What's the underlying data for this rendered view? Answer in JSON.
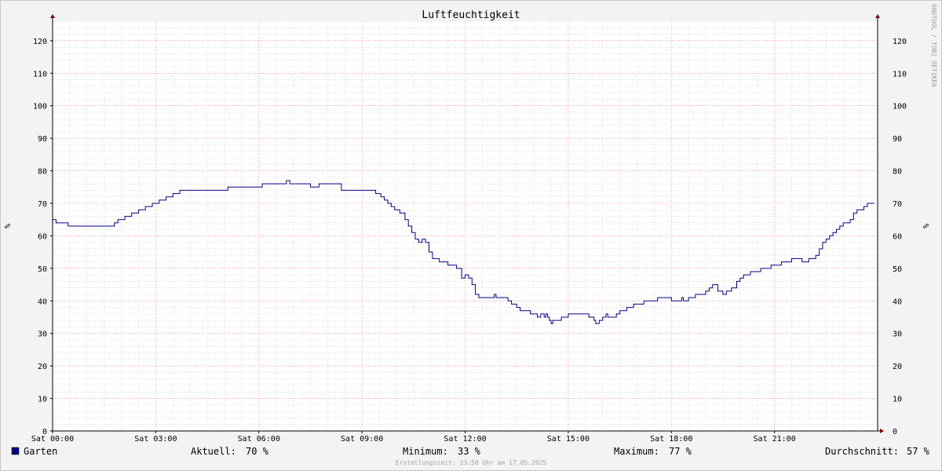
{
  "chart_data": {
    "type": "line",
    "title": "Luftfeuchtigkeit",
    "ylabel": "%",
    "ylim": [
      0,
      126
    ],
    "yticks": [
      0,
      10,
      20,
      30,
      40,
      50,
      60,
      70,
      80,
      90,
      100,
      110,
      120
    ],
    "xlim": [
      0,
      24
    ],
    "xticks": [
      {
        "hour": 0,
        "label": "Sat 00:00"
      },
      {
        "hour": 3,
        "label": "Sat 03:00"
      },
      {
        "hour": 6,
        "label": "Sat 06:00"
      },
      {
        "hour": 9,
        "label": "Sat 09:00"
      },
      {
        "hour": 12,
        "label": "Sat 12:00"
      },
      {
        "hour": 15,
        "label": "Sat 15:00"
      },
      {
        "hour": 18,
        "label": "Sat 18:00"
      },
      {
        "hour": 21,
        "label": "Sat 21:00"
      }
    ],
    "grid": true,
    "series": [
      {
        "name": "Garten",
        "color": "#00008b",
        "hours": [
          0,
          0.1,
          0.4,
          0.45,
          1.5,
          1.6,
          1.8,
          1.9,
          2.1,
          2.3,
          2.5,
          2.7,
          2.9,
          3.1,
          3.3,
          3.5,
          3.7,
          3.9,
          4.1,
          4.3,
          4.6,
          5.1,
          5.5,
          6.1,
          6.7,
          6.8,
          6.9,
          7.5,
          7.75,
          8.0,
          8.4,
          8.55,
          8.8,
          9.25,
          9.4,
          9.55,
          9.65,
          9.75,
          9.85,
          9.95,
          10.1,
          10.25,
          10.35,
          10.45,
          10.55,
          10.65,
          10.75,
          10.85,
          10.95,
          11.05,
          11.15,
          11.25,
          11.5,
          11.75,
          11.9,
          12.0,
          12.1,
          12.2,
          12.3,
          12.4,
          12.5,
          12.8,
          12.85,
          12.9,
          13.0,
          13.2,
          13.25,
          13.35,
          13.5,
          13.6,
          13.7,
          13.9,
          14.1,
          14.2,
          14.3,
          14.35,
          14.4,
          14.45,
          14.5,
          14.55,
          14.6,
          14.7,
          14.8,
          14.9,
          15.0,
          15.2,
          15.5,
          15.6,
          15.75,
          15.8,
          15.9,
          16.0,
          16.1,
          16.15,
          16.3,
          16.4,
          16.5,
          16.7,
          16.9,
          17.2,
          17.6,
          17.9,
          18.0,
          18.3,
          18.35,
          18.5,
          18.7,
          18.8,
          19.0,
          19.1,
          19.2,
          19.35,
          19.5,
          19.6,
          19.75,
          19.9,
          20.0,
          20.1,
          20.3,
          20.6,
          20.9,
          21.2,
          21.5,
          21.8,
          22.0,
          22.2,
          22.3,
          22.4,
          22.5,
          22.6,
          22.7,
          22.8,
          22.9,
          23.0,
          23.1,
          23.2,
          23.3,
          23.4,
          23.5,
          23.6,
          23.7,
          23.8,
          23.9,
          24.0
        ],
        "values": [
          65,
          64,
          64,
          63,
          63,
          63,
          64,
          65,
          66,
          67,
          68,
          69,
          70,
          71,
          72,
          73,
          74,
          74,
          74,
          74,
          74,
          75,
          75,
          76,
          76,
          77,
          76,
          75,
          76,
          76,
          74,
          74,
          74,
          74,
          73,
          72,
          71,
          70,
          69,
          68,
          67,
          65,
          63,
          61,
          59,
          58,
          59,
          58,
          55,
          53,
          53,
          52,
          51,
          50,
          47,
          48,
          47,
          45,
          42,
          41,
          41,
          41,
          42,
          41,
          41,
          41,
          40,
          39,
          38,
          37,
          37,
          36,
          35,
          36,
          35,
          36,
          35,
          34,
          33,
          34,
          34,
          34,
          35,
          35,
          36,
          36,
          36,
          35,
          34,
          33,
          34,
          35,
          36,
          35,
          35,
          36,
          37,
          38,
          39,
          40,
          41,
          41,
          40,
          41,
          40,
          41,
          42,
          42,
          43,
          44,
          45,
          43,
          42,
          43,
          44,
          46,
          47,
          48,
          49,
          50,
          51,
          52,
          53,
          52,
          53,
          54,
          56,
          58,
          59,
          60,
          61,
          62,
          63,
          64,
          64,
          65,
          67,
          68,
          68,
          69,
          70,
          70
        ]
      }
    ],
    "axis_arrow_color": "#800000",
    "major_grid_color": "#ff6a6a",
    "minor_grid_color": "#c8c8c8"
  },
  "watermark": "RRDTOOL / TOBI OETIKER",
  "legend": {
    "series_label": "Garten",
    "series_color": "#00008b",
    "current_label": "Aktuell:",
    "current_value": "70 %",
    "min_label": "Minimum:",
    "min_value": "33 %",
    "max_label": "Maximum:",
    "max_value": "77 %",
    "avg_label": "Durchschnitt:",
    "avg_value": "57 %"
  },
  "footer": "Erstellungszeit: 23:58 Uhr am 17.05.2025"
}
